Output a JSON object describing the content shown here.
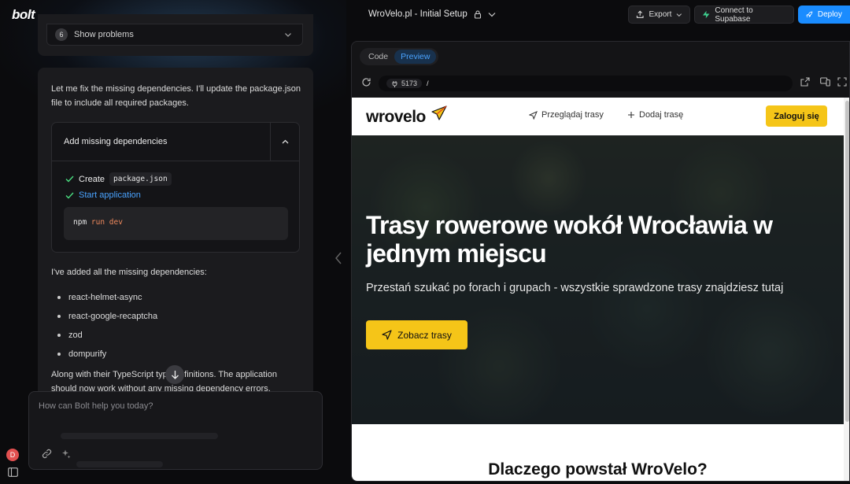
{
  "app": {
    "logo": "bolt",
    "project_title": "WroVelo.pl - Initial Setup",
    "export_label": "Export",
    "supabase_label": "Connect to Supabase",
    "deploy_label": "Deploy"
  },
  "chat": {
    "problems": {
      "count": "6",
      "label": "Show problems"
    },
    "intro": "Let me fix the missing dependencies. I'll update the package.json file to include all required packages.",
    "action": {
      "title": "Add missing dependencies",
      "step1_prefix": "Create",
      "step1_file": "package.json",
      "step2": "Start application",
      "cmd": "npm",
      "cmd_args": "run dev"
    },
    "added_text": "I've added all the missing dependencies:",
    "deps": [
      "react-helmet-async",
      "react-google-recaptcha",
      "zod",
      "dompurify"
    ],
    "outro": "Along with their TypeScript type definitions. The application should now work without any missing dependency errors.",
    "input_placeholder": "How can Bolt help you today?",
    "avatar_initial": "D"
  },
  "preview": {
    "tabs": [
      "Code",
      "Preview"
    ],
    "active_tab": "Preview",
    "port": "5173",
    "path": "/"
  },
  "site": {
    "brand": "wrovelo",
    "nav_browse": "Przeglądaj trasy",
    "nav_add": "Dodaj trasę",
    "login": "Zaloguj się",
    "hero_title": "Trasy rowerowe wokół Wrocławia w jednym miejscu",
    "hero_sub": "Przestań szukać po forach i grupach - wszystkie sprawdzone trasy znajdziesz tutaj",
    "cta": "Zobacz trasy",
    "section_title": "Dlaczego powstał WroVelo?"
  },
  "colors": {
    "accent_blue": "#1a8cff",
    "brand_yellow": "#f5c518",
    "supabase_green": "#3ecf8e",
    "success_green": "#4ade80"
  }
}
